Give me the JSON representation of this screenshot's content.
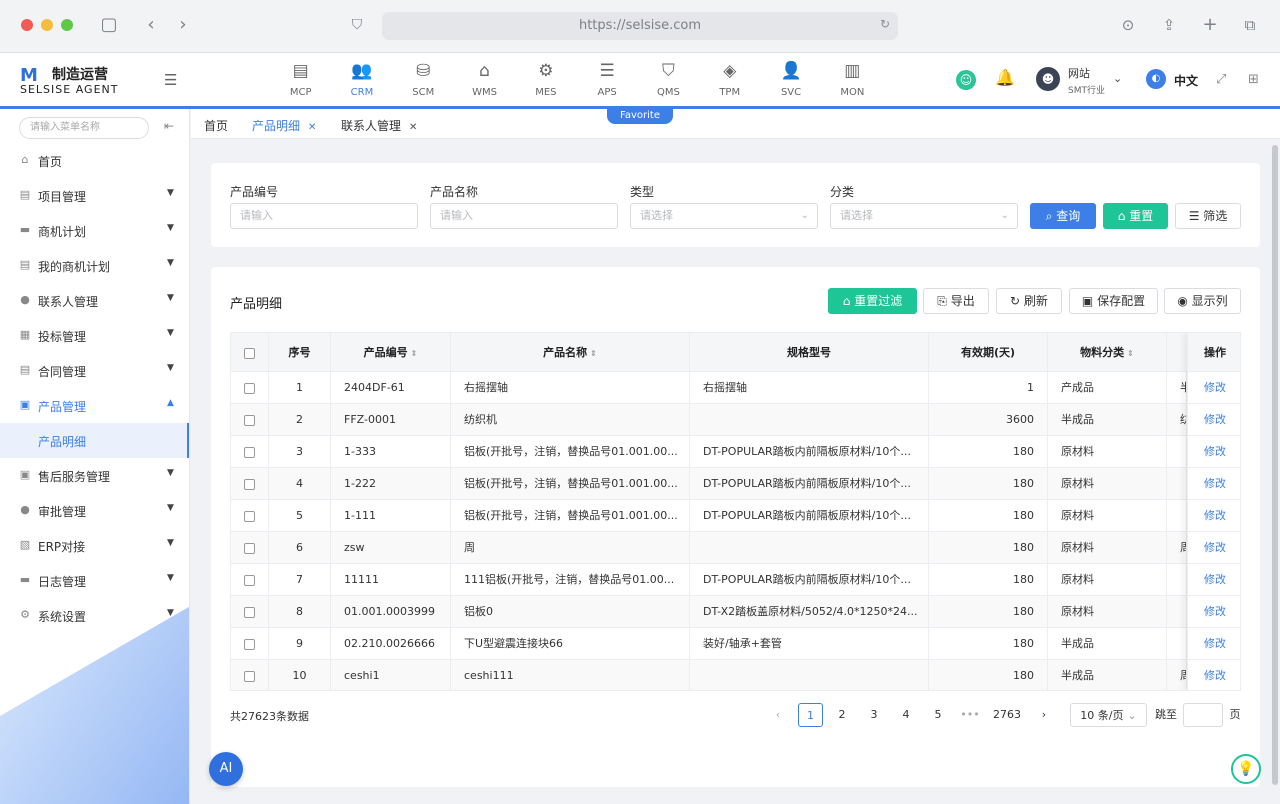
{
  "browser": {
    "url": "https://selsise.com"
  },
  "brand": {
    "cn": "制造运营",
    "en": "SELSISE AGENT",
    "logo": "M"
  },
  "modules": [
    {
      "label": "MCP",
      "icon": "▤"
    },
    {
      "label": "CRM",
      "icon": "👥"
    },
    {
      "label": "SCM",
      "icon": "⛁"
    },
    {
      "label": "WMS",
      "icon": "⌂"
    },
    {
      "label": "MES",
      "icon": "⚙"
    },
    {
      "label": "APS",
      "icon": "☰"
    },
    {
      "label": "QMS",
      "icon": "⛉"
    },
    {
      "label": "TPM",
      "icon": "◈"
    },
    {
      "label": "SVC",
      "icon": "👤"
    },
    {
      "label": "MON",
      "icon": "▥"
    }
  ],
  "favorite_label": "Favorite",
  "user": {
    "name": "网站",
    "org": "SMT行业"
  },
  "language": "中文",
  "sidebar": {
    "search_placeholder": "请输入菜单名称",
    "items": [
      {
        "label": "首页"
      },
      {
        "label": "项目管理"
      },
      {
        "label": "商机计划"
      },
      {
        "label": "我的商机计划"
      },
      {
        "label": "联系人管理"
      },
      {
        "label": "投标管理"
      },
      {
        "label": "合同管理"
      },
      {
        "label": "产品管理"
      },
      {
        "label": "售后服务管理"
      },
      {
        "label": "审批管理"
      },
      {
        "label": "ERP对接"
      },
      {
        "label": "日志管理"
      },
      {
        "label": "系统设置"
      }
    ],
    "sub_item": "产品明细"
  },
  "tabs": [
    {
      "label": "首页"
    },
    {
      "label": "产品明细"
    },
    {
      "label": "联系人管理"
    }
  ],
  "filters": {
    "product_code": {
      "label": "产品编号",
      "placeholder": "请输入"
    },
    "product_name": {
      "label": "产品名称",
      "placeholder": "请输入"
    },
    "type": {
      "label": "类型",
      "placeholder": "请选择"
    },
    "category": {
      "label": "分类",
      "placeholder": "请选择"
    },
    "query_btn": "查询",
    "reset_btn": "重置",
    "filter_btn": "筛选"
  },
  "table_card": {
    "title": "产品明细",
    "reset_filter": "重置过滤",
    "export": "导出",
    "refresh": "刷新",
    "save_config": "保存配置",
    "show_columns": "显示列"
  },
  "columns": [
    "序号",
    "产品编号",
    "产品名称",
    "规格型号",
    "有效期(天)",
    "物料分类",
    "操作"
  ],
  "rows": [
    {
      "no": "1",
      "code": "2404DF-61",
      "name": "右摇摆轴",
      "spec": "右摇摆轴",
      "days": "1",
      "cat": "产成品",
      "extra": "半",
      "op": "修改"
    },
    {
      "no": "2",
      "code": "FFZ-0001",
      "name": "纺织机",
      "spec": "",
      "days": "3600",
      "cat": "半成品",
      "extra": "纺",
      "op": "修改"
    },
    {
      "no": "3",
      "code": "1-333",
      "name": "铝板(开批号，注销，替换品号01.001.00...",
      "spec": "DT-POPULAR踏板内前隔板原材料/10个...",
      "days": "180",
      "cat": "原材料",
      "extra": "",
      "op": "修改"
    },
    {
      "no": "4",
      "code": "1-222",
      "name": "铝板(开批号，注销，替换品号01.001.00...",
      "spec": "DT-POPULAR踏板内前隔板原材料/10个...",
      "days": "180",
      "cat": "原材料",
      "extra": "",
      "op": "修改"
    },
    {
      "no": "5",
      "code": "1-111",
      "name": "铝板(开批号，注销，替换品号01.001.00...",
      "spec": "DT-POPULAR踏板内前隔板原材料/10个...",
      "days": "180",
      "cat": "原材料",
      "extra": "",
      "op": "修改"
    },
    {
      "no": "6",
      "code": "zsw",
      "name": "周",
      "spec": "",
      "days": "180",
      "cat": "原材料",
      "extra": "周",
      "op": "修改"
    },
    {
      "no": "7",
      "code": "11111",
      "name": "111铝板(开批号，注销，替换品号01.00...",
      "spec": "DT-POPULAR踏板内前隔板原材料/10个...",
      "days": "180",
      "cat": "原材料",
      "extra": "",
      "op": "修改"
    },
    {
      "no": "8",
      "code": "01.001.0003999",
      "name": "铝板0",
      "spec": "DT-X2踏板盖原材料/5052/4.0*1250*24...",
      "days": "180",
      "cat": "原材料",
      "extra": "",
      "op": "修改"
    },
    {
      "no": "9",
      "code": "02.210.0026666",
      "name": "下U型避震连接块66",
      "spec": "装好/轴承+套管",
      "days": "180",
      "cat": "半成品",
      "extra": "",
      "op": "修改"
    },
    {
      "no": "10",
      "code": "ceshi1",
      "name": "ceshi111",
      "spec": "",
      "days": "180",
      "cat": "半成品",
      "extra": "周",
      "op": "修改"
    }
  ],
  "pagination": {
    "total": "共27623条数据",
    "pages": [
      "1",
      "2",
      "3",
      "4",
      "5",
      "•••",
      "2763"
    ],
    "page_size": "10 条/页",
    "goto_label": "跳至",
    "page_suffix": "页"
  },
  "ai_label": "AI"
}
